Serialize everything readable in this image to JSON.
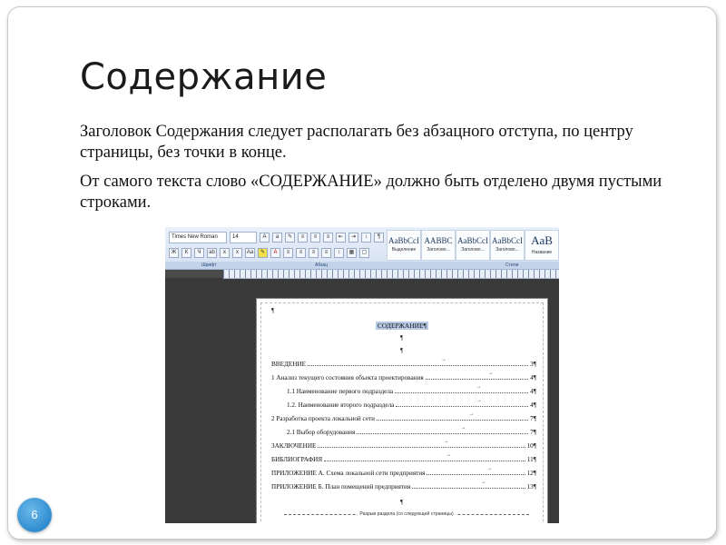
{
  "slide": {
    "title": "Содержание",
    "paragraphs": [
      "Заголовок Содержания следует располагать без абзацного отступа, по центру страницы, без точки в конце.",
      "От самого текста слово «СОДЕРЖАНИЕ» должно быть отделено двумя пустыми строками."
    ],
    "slide_number": "6"
  },
  "word_screenshot": {
    "ribbon": {
      "font_name": "Times New Roman",
      "font_size": "14",
      "groups": [
        "Шрифт",
        "Абзац",
        "Стили"
      ],
      "styles": [
        {
          "sample": "AaBbCcI",
          "name": "Выделение"
        },
        {
          "sample": "AABBC",
          "name": "Заголово..."
        },
        {
          "sample": "AaBbCcI",
          "name": "Заголово..."
        },
        {
          "sample": "AaBbCcI",
          "name": "Заголово..."
        },
        {
          "sample": "AaB",
          "name": "Название"
        }
      ]
    },
    "document": {
      "pilcrow": "¶",
      "toc_heading": "СОДЕРЖАНИЕ¶",
      "entries": [
        {
          "text": "ВВЕДЕНИЕ",
          "page": "3¶",
          "level": 1
        },
        {
          "text": "1 Анализ текущего состояния объекта проектирования",
          "page": "4¶",
          "level": 1
        },
        {
          "text": "1.1 Наименование первого подраздела",
          "page": "4¶",
          "level": 2
        },
        {
          "text": "1.2. Наименование второго подраздела",
          "page": "4¶",
          "level": 2
        },
        {
          "text": "2 Разработка проекта локальной сети",
          "page": "7¶",
          "level": 1
        },
        {
          "text": "2.1 Выбор оборудования",
          "page": "7¶",
          "level": 2
        },
        {
          "text": "ЗАКЛЮЧЕНИЕ",
          "page": "10¶",
          "level": 1
        },
        {
          "text": "БИБЛИОГРАФИЯ",
          "page": "11¶",
          "level": 1
        },
        {
          "text": "ПРИЛОЖЕНИЕ А. Схема локальной сети предприятия",
          "page": "12¶",
          "level": 1
        },
        {
          "text": "ПРИЛОЖЕНИЕ Б. План помещений предприятия",
          "page": "13¶",
          "level": 1
        }
      ],
      "section_break": "Разрыв раздела (со следующей страницы)"
    }
  },
  "colors": {
    "slide_number_bg": "#2f8ccf",
    "selection": "#b8cbe6",
    "ribbon": "#d5e1f2"
  }
}
